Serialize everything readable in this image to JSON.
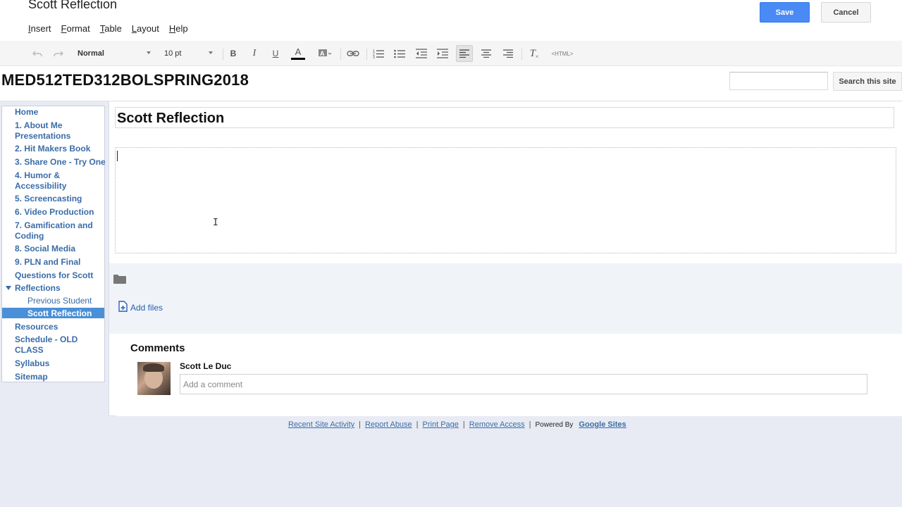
{
  "editor": {
    "doc_title": "Scott Reflection",
    "menu": [
      "Insert",
      "Format",
      "Table",
      "Layout",
      "Help"
    ],
    "save_label": "Save",
    "cancel_label": "Cancel"
  },
  "toolbar": {
    "style_value": "Normal",
    "size_value": "10 pt",
    "bold_glyph": "B",
    "italic_glyph": "I",
    "underline_glyph": "U",
    "text_color_glyph": "A",
    "html_label": "<HTML>",
    "clear_format_glyph": "T",
    "text_color": "#000000"
  },
  "site": {
    "name": "MED512TED312BOLSPRING2018",
    "search_button": "Search this site",
    "search_value": ""
  },
  "sidebar": {
    "items": [
      "Home",
      "1. About Me Presentations",
      "2. Hit Makers Book",
      "3. Share One - Try One",
      "4. Humor & Accessibility",
      "5. Screencasting",
      "6. Video Production",
      "7. Gamification and Coding",
      "8. Social Media",
      "9. PLN and Final",
      "Questions for Scott",
      "Reflections",
      "Previous Student",
      "Scott Reflection",
      "Resources",
      "Schedule - OLD CLASS",
      "Syllabus",
      "Sitemap"
    ],
    "selected_color": "#4a90d9"
  },
  "page": {
    "title": "Scott Reflection",
    "body_text": "",
    "add_files": "Add files"
  },
  "comments": {
    "heading": "Comments",
    "user": "Scott Le Duc",
    "placeholder": "Add a comment"
  },
  "footer": {
    "links": [
      "Recent Site Activity",
      "Report Abuse",
      "Print Page",
      "Remove Access"
    ],
    "powered_by": "Powered By",
    "brand": "Google Sites"
  },
  "colors": {
    "accent": "#4a8af4",
    "link": "#3a6ca8"
  }
}
